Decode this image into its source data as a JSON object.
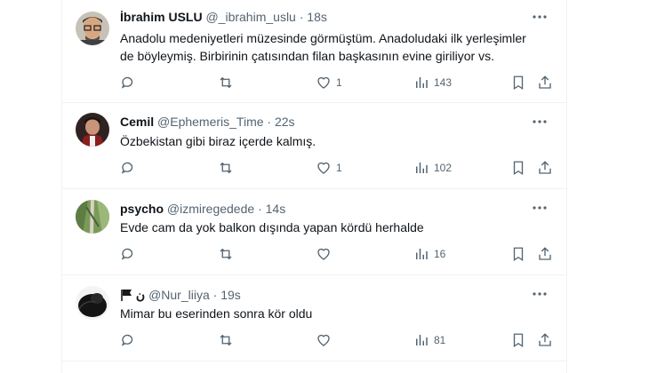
{
  "tweets": [
    {
      "name": "İbrahim USLU",
      "handle": "@_ibrahim_uslu",
      "sep": "·",
      "time": "18s",
      "text": "Anadolu medeniyetleri müzesinde görmüştüm. Anadoludaki ilk yerleşimler de böyleymiş. Birbirinin çatısından filan başkasının evine giriliyor vs.",
      "likes": "1",
      "views": "143"
    },
    {
      "name": "Cemil",
      "handle": "@Ephemeris_Time",
      "sep": "·",
      "time": "22s",
      "text": "Özbekistan gibi biraz içerde kalmış.",
      "likes": "1",
      "views": "102"
    },
    {
      "name": "psycho",
      "handle": "@izmiregedede",
      "sep": "·",
      "time": "14s",
      "text": "Evde cam da yok balkon dışında yapan kördü herhalde",
      "likes": "",
      "views": "16"
    },
    {
      "name": "ن",
      "handle": "@Nur_liiya",
      "sep": "·",
      "time": "19s",
      "text": "Mimar bu eserinden sonra kör oldu",
      "likes": "",
      "views": "81"
    }
  ],
  "icons": [
    "more-icon",
    "reply-icon",
    "retweet-icon",
    "like-icon",
    "views-icon",
    "bookmark-icon",
    "share-icon",
    "flag-icon"
  ],
  "colors": {
    "text": "#0f1419",
    "secondary": "#536471",
    "divider": "#eff3f4"
  }
}
